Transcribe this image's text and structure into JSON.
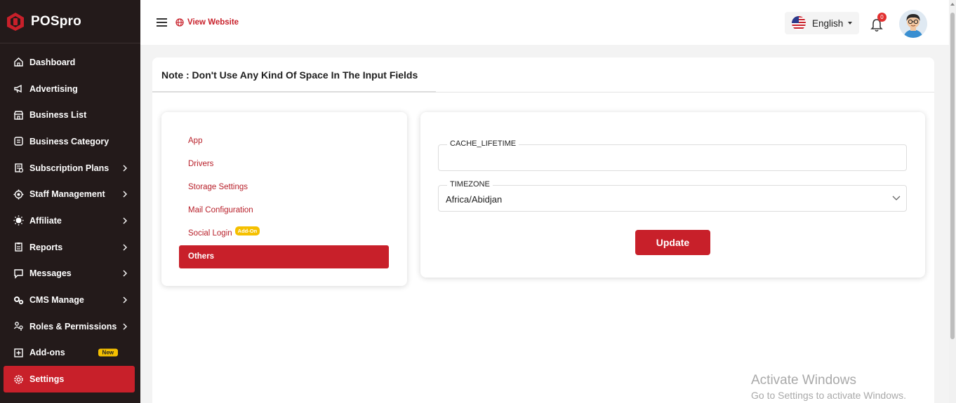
{
  "app": {
    "name": "POSpro"
  },
  "sidebar": {
    "items": [
      {
        "label": "Dashboard",
        "icon": "home-icon",
        "has_chevron": false
      },
      {
        "label": "Advertising",
        "icon": "megaphone-icon",
        "has_chevron": false
      },
      {
        "label": "Business List",
        "icon": "store-icon",
        "has_chevron": false
      },
      {
        "label": "Business Category",
        "icon": "category-icon",
        "has_chevron": false
      },
      {
        "label": "Subscription Plans",
        "icon": "subscription-icon",
        "has_chevron": true
      },
      {
        "label": "Staff Management",
        "icon": "staff-icon",
        "has_chevron": true
      },
      {
        "label": "Affiliate",
        "icon": "affiliate-icon",
        "has_chevron": true
      },
      {
        "label": "Reports",
        "icon": "reports-icon",
        "has_chevron": true
      },
      {
        "label": "Messages",
        "icon": "message-icon",
        "has_chevron": true
      },
      {
        "label": "CMS Manage",
        "icon": "cms-icon",
        "has_chevron": true
      },
      {
        "label": "Roles & Permissions",
        "icon": "roles-icon",
        "has_chevron": true
      },
      {
        "label": "Add-ons",
        "icon": "add-icon",
        "has_chevron": false,
        "badge": "New"
      },
      {
        "label": "Settings",
        "icon": "gear-icon",
        "has_chevron": false,
        "active": true
      }
    ]
  },
  "topbar": {
    "view_website": "View Website",
    "language": "English",
    "notification_count": "0"
  },
  "card": {
    "note": "Note : Don't Use Any Kind Of Space In The Input Fields"
  },
  "tabs": [
    {
      "label": "App"
    },
    {
      "label": "Drivers"
    },
    {
      "label": "Storage Settings"
    },
    {
      "label": "Mail Configuration"
    },
    {
      "label": "Social Login",
      "badge": "Add-On"
    },
    {
      "label": "Others",
      "active": true
    }
  ],
  "form": {
    "cache_lifetime": {
      "label": "CACHE_LIFETIME",
      "value": ""
    },
    "timezone": {
      "label": "TIMEZONE",
      "value": "Africa/Abidjan"
    },
    "update_label": "Update"
  },
  "watermark": {
    "line1": "Activate Windows",
    "line2": "Go to Settings to activate Windows."
  },
  "colors": {
    "brand": "#c8202a",
    "sidebar_bg": "#231a1a",
    "badge_yellow": "#f5c000"
  }
}
